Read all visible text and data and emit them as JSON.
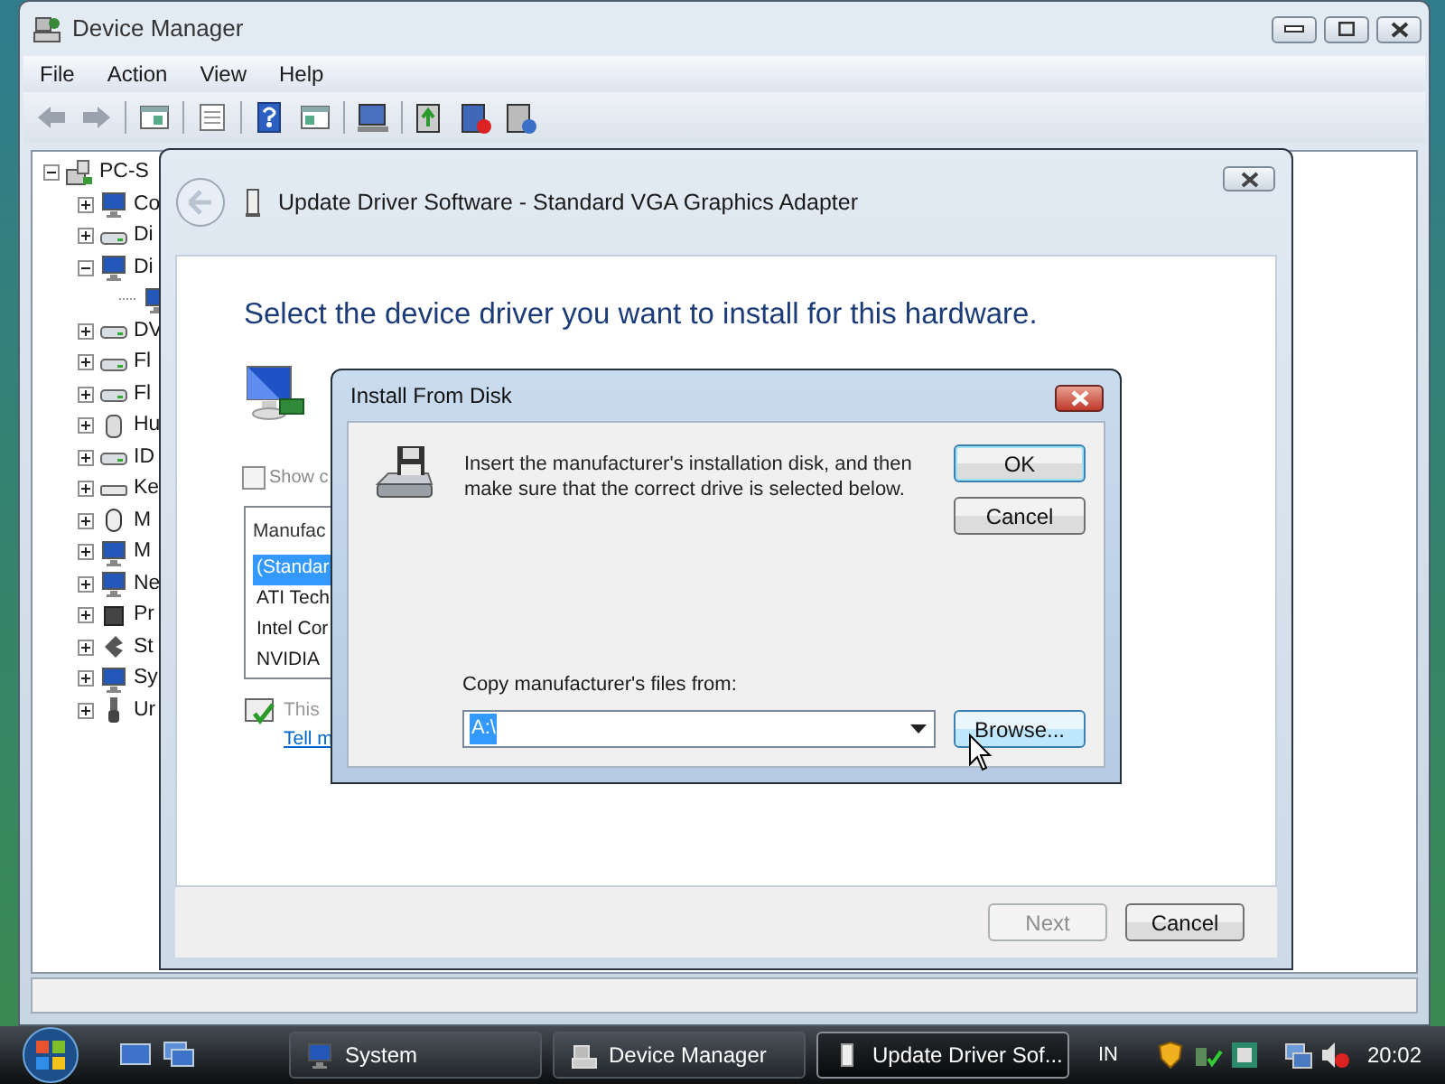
{
  "device_manager": {
    "title": "Device Manager",
    "menu": [
      "File",
      "Action",
      "View",
      "Help"
    ],
    "tree": {
      "label": "PC-S",
      "expanded": true,
      "children": [
        {
          "kind": "category",
          "label": "Co",
          "expanded": false
        },
        {
          "kind": "category",
          "label": "Di",
          "expanded": false
        },
        {
          "kind": "category",
          "label": "Di",
          "expanded": true,
          "children": [
            {
              "kind": "device"
            }
          ]
        },
        {
          "kind": "category",
          "label": "DV",
          "expanded": false
        },
        {
          "kind": "category",
          "label": "Fl",
          "expanded": false
        },
        {
          "kind": "category",
          "label": "Fl",
          "expanded": false
        },
        {
          "kind": "category",
          "label": "Hu",
          "expanded": false
        },
        {
          "kind": "category",
          "label": "ID",
          "expanded": false
        },
        {
          "kind": "category",
          "label": "Ke",
          "expanded": false
        },
        {
          "kind": "category",
          "label": "M",
          "expanded": false
        },
        {
          "kind": "category",
          "label": "M",
          "expanded": false
        },
        {
          "kind": "category",
          "label": "Ne",
          "expanded": false
        },
        {
          "kind": "category",
          "label": "Pr",
          "expanded": false
        },
        {
          "kind": "category",
          "label": "St",
          "expanded": false
        },
        {
          "kind": "category",
          "label": "Sy",
          "expanded": false
        },
        {
          "kind": "category",
          "label": "Ur",
          "expanded": false
        }
      ]
    }
  },
  "wizard": {
    "title": "Update Driver Software - Standard VGA Graphics Adapter",
    "heading": "Select the device driver you want to install for this hardware.",
    "show_compatible": {
      "label": "Show c",
      "checked": false
    },
    "list": {
      "header": "Manufac",
      "items": [
        {
          "label": "(Standar",
          "selected": true
        },
        {
          "label": "ATI Tech",
          "selected": false
        },
        {
          "label": "Intel Cor",
          "selected": false
        },
        {
          "label": "NVIDIA",
          "selected": false
        }
      ]
    },
    "signed_note": "This",
    "link": "Tell m",
    "buttons": [
      {
        "label": "Next",
        "disabled": true
      },
      {
        "label": "Cancel",
        "disabled": false
      }
    ]
  },
  "install_dialog": {
    "title": "Install From Disk",
    "message": "Insert the manufacturer's installation disk, and then make sure that the correct drive is selected below.",
    "buttons": [
      {
        "label": "OK",
        "default": true
      },
      {
        "label": "Cancel",
        "default": false
      }
    ],
    "source_label": "Copy manufacturer's files from:",
    "source": {
      "value": "A:\\",
      "highlighted": true
    },
    "browse": {
      "label": "Browse...",
      "hover": true
    }
  },
  "taskbar": {
    "tasks": [
      {
        "label": "System",
        "selected": false
      },
      {
        "label": "Device Manager",
        "selected": false
      },
      {
        "label": "Update Driver Sof...",
        "selected": true
      }
    ],
    "language": "IN",
    "clock": "20:02"
  }
}
